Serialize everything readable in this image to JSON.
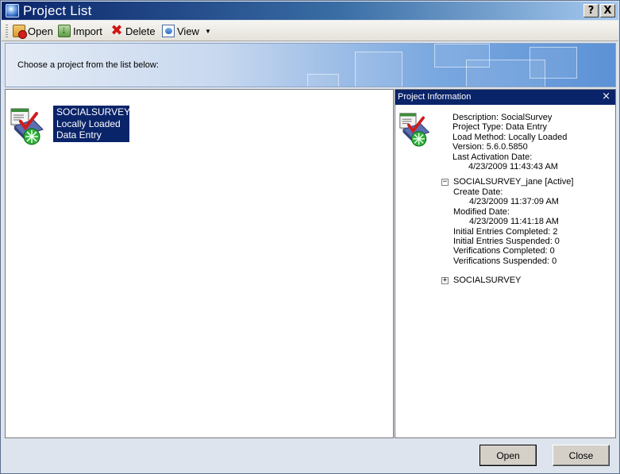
{
  "window": {
    "title": "Project List",
    "help_label": "?",
    "close_label": "X"
  },
  "toolbar": {
    "open_label": "Open",
    "import_label": "Import",
    "delete_label": "Delete",
    "view_label": "View",
    "delete_glyph": "✖"
  },
  "banner": {
    "prompt": "Choose a project from the list below:"
  },
  "project_list": {
    "items": [
      {
        "name": "SOCIALSURVEY",
        "status": "Locally Loaded",
        "type": "Data Entry"
      }
    ]
  },
  "info_panel": {
    "title": "Project Information",
    "close_label": "×",
    "description": "Description:  SocialSurvey",
    "project_type": "Project Type:  Data Entry",
    "load_method": "Load Method:  Locally Loaded",
    "version": "Version:  5.6.0.5850",
    "last_activation_label": "Last Activation Date:",
    "last_activation_value": "4/23/2009 11:43:43 AM",
    "session": {
      "toggle": "−",
      "name": "SOCIALSURVEY_jane [Active]",
      "create_label": "Create Date:",
      "create_value": "4/23/2009 11:37:09 AM",
      "modified_label": "Modified Date:",
      "modified_value": "4/23/2009 11:41:18 AM",
      "initial_completed": "Initial Entries Completed:  2",
      "initial_suspended": "Initial Entries Suspended:  0",
      "verif_completed": "Verifications Completed:  0",
      "verif_suspended": "Verifications Suspended:  0"
    },
    "collapsed_node": {
      "toggle": "+",
      "name": "SOCIALSURVEY"
    }
  },
  "buttons": {
    "open_label": "Open",
    "close_label": "Close"
  }
}
